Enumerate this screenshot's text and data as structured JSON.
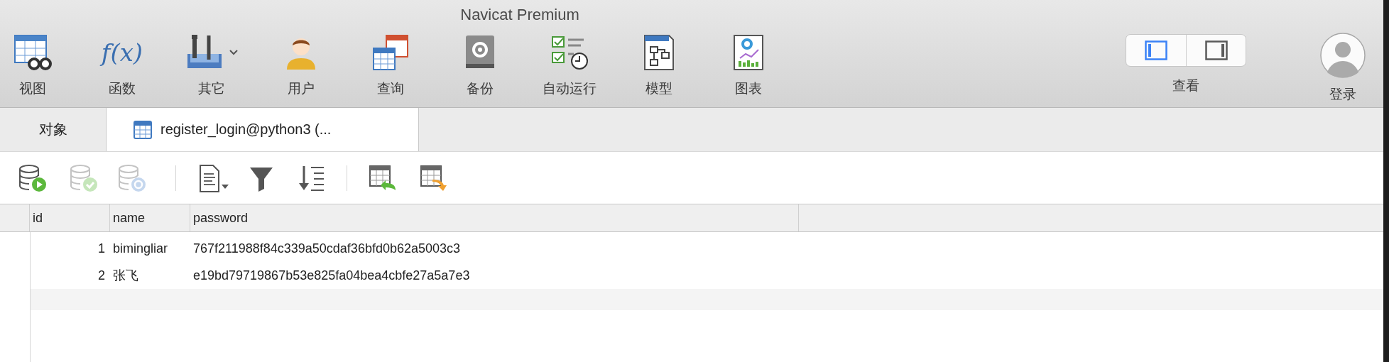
{
  "window": {
    "title": "Navicat Premium"
  },
  "toolbar": [
    {
      "label": "视图"
    },
    {
      "label": "函数",
      "glyph": "f(x)"
    },
    {
      "label": "其它",
      "has_menu": true
    },
    {
      "label": "用户"
    },
    {
      "label": "查询"
    },
    {
      "label": "备份"
    },
    {
      "label": "自动运行"
    },
    {
      "label": "模型"
    },
    {
      "label": "图表"
    }
  ],
  "view_control": {
    "label": "查看",
    "segments": [
      {
        "selected": true
      },
      {
        "selected": false
      }
    ]
  },
  "login": {
    "label": "登录"
  },
  "tabs": [
    {
      "label": "对象",
      "selected": false,
      "has_icon": false
    },
    {
      "label": "register_login@python3 (...",
      "selected": true,
      "has_icon": true
    }
  ],
  "actions": [
    {
      "disabled": false
    },
    {
      "disabled": true
    },
    {
      "disabled": true
    },
    {
      "disabled": false,
      "separator_before": true
    },
    {
      "disabled": false
    },
    {
      "disabled": false
    },
    {
      "disabled": false,
      "separator_before": true
    },
    {
      "disabled": false
    }
  ],
  "table": {
    "columns": [
      "id",
      "name",
      "password"
    ],
    "rows": [
      [
        "1",
        "bimingliar",
        "767f211988f84c339a50cdaf36bfd0b62a5003c3"
      ],
      [
        "2",
        "张飞",
        "e19bd79719867b53e825fa04bea4cbfe27a5a7e3"
      ]
    ]
  }
}
